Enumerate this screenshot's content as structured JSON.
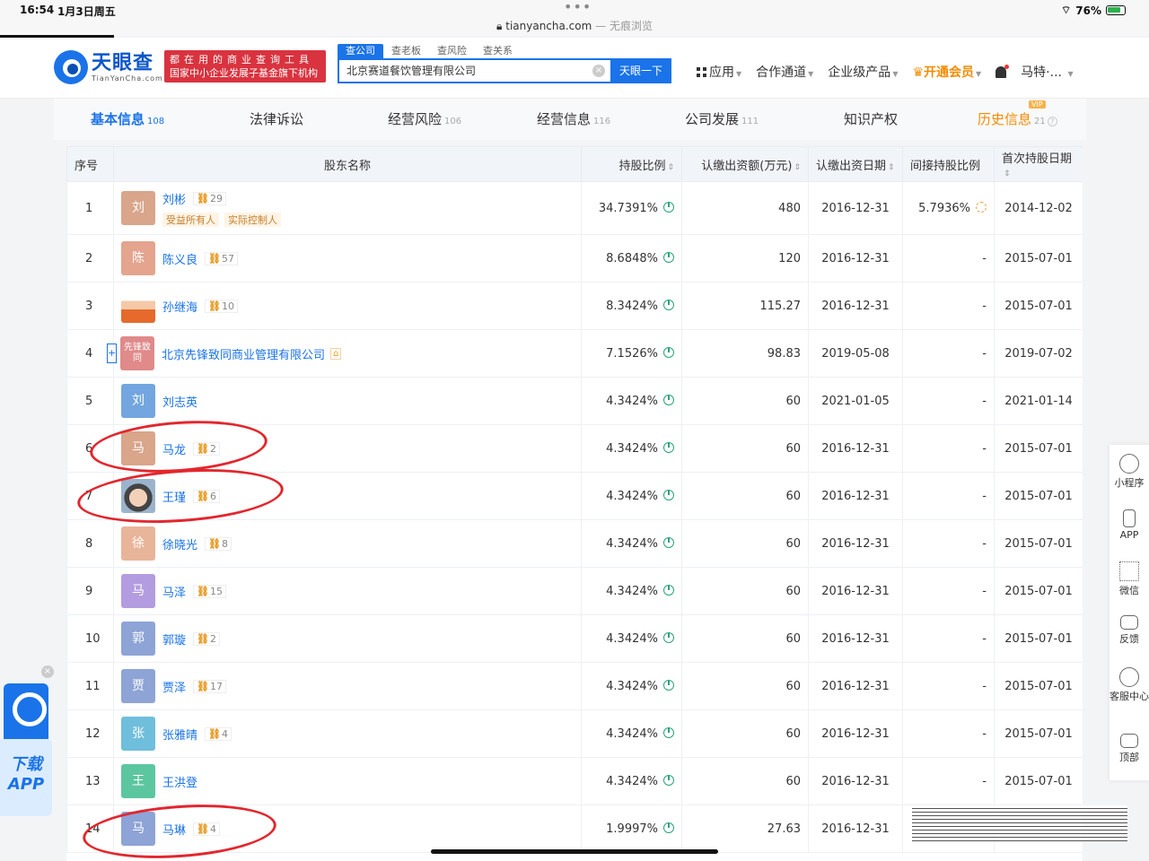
{
  "status_bar": {
    "time": "16:54",
    "date": "1月3日周五",
    "url": "tianyancha.com",
    "private_label": "— 无痕浏览",
    "battery": "76%"
  },
  "header": {
    "logo_cn": "天眼查",
    "logo_en": "TianYanCha.com",
    "slogan_line1": "都在用的商业查询工具",
    "slogan_line2": "国家中小企业发展子基金旗下机构",
    "search_tabs": [
      "查公司",
      "查老板",
      "查风险",
      "查关系"
    ],
    "search_value": "北京赛道餐饮管理有限公司",
    "search_button": "天眼一下",
    "nav": {
      "apps": "应用",
      "partner": "合作通道",
      "enterprise": "企业级产品",
      "vip": "开通会员",
      "user": "马特·..."
    }
  },
  "category_tabs": [
    {
      "label": "基本信息",
      "count": "108"
    },
    {
      "label": "法律诉讼",
      "count": ""
    },
    {
      "label": "经营风险",
      "count": "106"
    },
    {
      "label": "经营信息",
      "count": "116"
    },
    {
      "label": "公司发展",
      "count": "111"
    },
    {
      "label": "知识产权",
      "count": ""
    },
    {
      "label": "历史信息",
      "count": "21"
    }
  ],
  "vip_badge": "VIP",
  "table": {
    "headers": [
      "序号",
      "股东名称",
      "持股比例",
      "认缴出资额(万元)",
      "认缴出资日期",
      "间接持股比例",
      "首次持股日期"
    ],
    "rows": [
      {
        "seq": "1",
        "avatar": "刘",
        "color": "#d9a58b",
        "name": "刘彬",
        "rel": "29",
        "tags": [
          "受益所有人",
          "实际控制人"
        ],
        "ratio": "34.7391%",
        "amount": "480",
        "date": "2016-12-31",
        "indirect": "5.7936%",
        "first": "2014-12-02"
      },
      {
        "seq": "2",
        "avatar": "陈",
        "color": "#e4a48e",
        "name": "陈义良",
        "rel": "57",
        "ratio": "8.6848%",
        "amount": "120",
        "date": "2016-12-31",
        "indirect": "-",
        "first": "2015-07-01"
      },
      {
        "seq": "3",
        "avatar": "",
        "color": "",
        "photo": "photo1",
        "name": "孙继海",
        "rel": "10",
        "ratio": "8.3424%",
        "amount": "115.27",
        "date": "2016-12-31",
        "indirect": "-",
        "first": "2015-07-01"
      },
      {
        "seq": "4",
        "avatar": "先锋致同",
        "color": "#e08a8a",
        "name": "北京先锋致同商业管理有限公司",
        "company": true,
        "ratio": "7.1526%",
        "amount": "98.83",
        "date": "2019-05-08",
        "indirect": "-",
        "first": "2019-07-02"
      },
      {
        "seq": "5",
        "avatar": "刘",
        "color": "#73a6e0",
        "name": "刘志英",
        "ratio": "4.3424%",
        "amount": "60",
        "date": "2021-01-05",
        "indirect": "-",
        "first": "2021-01-14"
      },
      {
        "seq": "6",
        "avatar": "马",
        "color": "#d9a58b",
        "name": "马龙",
        "rel": "2",
        "ratio": "4.3424%",
        "amount": "60",
        "date": "2016-12-31",
        "indirect": "-",
        "first": "2015-07-01"
      },
      {
        "seq": "7",
        "avatar": "",
        "color": "",
        "photo": "photo2",
        "name": "王瑾",
        "rel": "6",
        "ratio": "4.3424%",
        "amount": "60",
        "date": "2016-12-31",
        "indirect": "-",
        "first": "2015-07-01"
      },
      {
        "seq": "8",
        "avatar": "徐",
        "color": "#e8b49a",
        "name": "徐晓光",
        "rel": "8",
        "ratio": "4.3424%",
        "amount": "60",
        "date": "2016-12-31",
        "indirect": "-",
        "first": "2015-07-01"
      },
      {
        "seq": "9",
        "avatar": "马",
        "color": "#b39ce0",
        "name": "马泽",
        "rel": "15",
        "ratio": "4.3424%",
        "amount": "60",
        "date": "2016-12-31",
        "indirect": "-",
        "first": "2015-07-01"
      },
      {
        "seq": "10",
        "avatar": "郭",
        "color": "#8ea3d6",
        "name": "郭璇",
        "rel": "2",
        "ratio": "4.3424%",
        "amount": "60",
        "date": "2016-12-31",
        "indirect": "-",
        "first": "2015-07-01"
      },
      {
        "seq": "11",
        "avatar": "贾",
        "color": "#8ea3d6",
        "name": "贾泽",
        "rel": "17",
        "ratio": "4.3424%",
        "amount": "60",
        "date": "2016-12-31",
        "indirect": "-",
        "first": "2015-07-01"
      },
      {
        "seq": "12",
        "avatar": "张",
        "color": "#6fbedc",
        "name": "张雅晴",
        "rel": "4",
        "ratio": "4.3424%",
        "amount": "60",
        "date": "2016-12-31",
        "indirect": "-",
        "first": "2015-07-01"
      },
      {
        "seq": "13",
        "avatar": "王",
        "color": "#5cc6a0",
        "name": "王洪登",
        "ratio": "4.3424%",
        "amount": "60",
        "date": "2016-12-31",
        "indirect": "-",
        "first": "2015-07-01"
      },
      {
        "seq": "14",
        "avatar": "马",
        "color": "#8ea3d6",
        "name": "马琳",
        "rel": "4",
        "ratio": "1.9997%",
        "amount": "27.63",
        "date": "2016-12-31",
        "indirect": "",
        "first": ""
      }
    ]
  },
  "float_sidebar": [
    "小程序",
    "APP",
    "微信",
    "反馈",
    "客服中心",
    "顶部"
  ],
  "app_widget": {
    "line1": "下载",
    "line2": "APP"
  }
}
